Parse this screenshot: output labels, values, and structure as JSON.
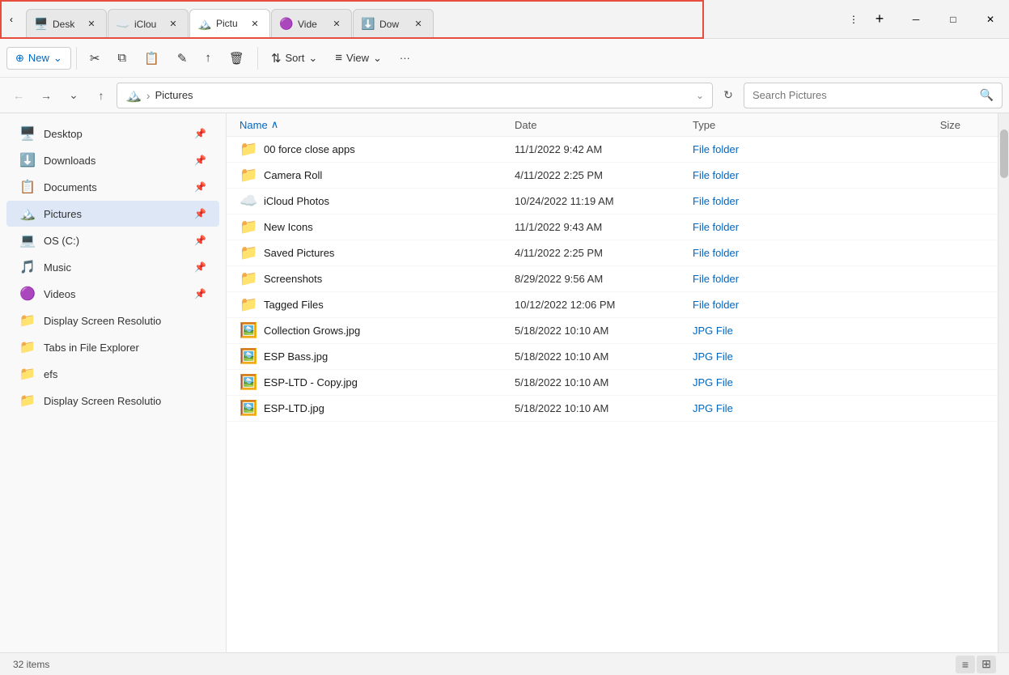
{
  "window": {
    "title": "Pictures",
    "min_label": "─",
    "max_label": "□",
    "close_label": "✕"
  },
  "tabs": [
    {
      "id": "desktop",
      "label": "Desk",
      "icon": "🖥️",
      "active": false
    },
    {
      "id": "icloud",
      "label": "iClou",
      "icon": "☁️",
      "active": false
    },
    {
      "id": "pictures",
      "label": "Pictu",
      "icon": "🏔️",
      "active": true
    },
    {
      "id": "videos",
      "label": "Vide",
      "icon": "🟣",
      "active": false
    },
    {
      "id": "downloads",
      "label": "Dow",
      "icon": "⬇️",
      "active": false
    }
  ],
  "toolbar": {
    "new_label": "New",
    "sort_label": "Sort",
    "view_label": "View",
    "more_label": "···"
  },
  "address": {
    "back_label": "←",
    "forward_label": "→",
    "dropdown_label": "⌄",
    "up_label": "↑",
    "breadcrumb_icon": "🏔️",
    "breadcrumb_sep": "›",
    "breadcrumb_text": "Pictures",
    "refresh_label": "↻",
    "search_placeholder": "Search Pictures"
  },
  "sidebar": {
    "items": [
      {
        "id": "desktop",
        "icon": "🖥️",
        "label": "Desktop",
        "pinned": true
      },
      {
        "id": "downloads",
        "icon": "⬇️",
        "label": "Downloads",
        "pinned": true
      },
      {
        "id": "documents",
        "icon": "📋",
        "label": "Documents",
        "pinned": true
      },
      {
        "id": "pictures",
        "icon": "🏔️",
        "label": "Pictures",
        "pinned": true,
        "active": true
      },
      {
        "id": "osc",
        "icon": "💻",
        "label": "OS (C:)",
        "pinned": true
      },
      {
        "id": "music",
        "icon": "🎵",
        "label": "Music",
        "pinned": true
      },
      {
        "id": "videos",
        "icon": "🟣",
        "label": "Videos",
        "pinned": true
      },
      {
        "id": "display1",
        "icon": "📁",
        "label": "Display Screen Resolutio",
        "pinned": false
      },
      {
        "id": "tabs",
        "icon": "📁",
        "label": "Tabs in File Explorer",
        "pinned": false
      },
      {
        "id": "efs",
        "icon": "📁",
        "label": "efs",
        "pinned": false
      },
      {
        "id": "display2",
        "icon": "📁",
        "label": "Display Screen Resolutio",
        "pinned": false
      }
    ]
  },
  "content": {
    "headers": {
      "name": "Name",
      "name_sort_icon": "∧",
      "date": "Date",
      "type": "Type",
      "size": "Size"
    },
    "files": [
      {
        "name": "00 force close apps",
        "icon": "📁",
        "date": "11/1/2022 9:42 AM",
        "type": "File folder",
        "size": ""
      },
      {
        "name": "Camera Roll",
        "icon": "📁",
        "date": "4/11/2022 2:25 PM",
        "type": "File folder",
        "size": ""
      },
      {
        "name": "iCloud Photos",
        "icon": "☁️",
        "date": "10/24/2022 11:19 AM",
        "type": "File folder",
        "size": ""
      },
      {
        "name": "New Icons",
        "icon": "📁",
        "date": "11/1/2022 9:43 AM",
        "type": "File folder",
        "size": ""
      },
      {
        "name": "Saved Pictures",
        "icon": "📁",
        "date": "4/11/2022 2:25 PM",
        "type": "File folder",
        "size": ""
      },
      {
        "name": "Screenshots",
        "icon": "📁",
        "date": "8/29/2022 9:56 AM",
        "type": "File folder",
        "size": ""
      },
      {
        "name": "Tagged Files",
        "icon": "📁",
        "date": "10/12/2022 12:06 PM",
        "type": "File folder",
        "size": ""
      },
      {
        "name": "Collection Grows.jpg",
        "icon": "🖼️",
        "date": "5/18/2022 10:10 AM",
        "type": "JPG File",
        "size": ""
      },
      {
        "name": "ESP Bass.jpg",
        "icon": "🖼️",
        "date": "5/18/2022 10:10 AM",
        "type": "JPG File",
        "size": ""
      },
      {
        "name": "ESP-LTD - Copy.jpg",
        "icon": "🖼️",
        "date": "5/18/2022 10:10 AM",
        "type": "JPG File",
        "size": ""
      },
      {
        "name": "ESP-LTD.jpg",
        "icon": "🖼️",
        "date": "5/18/2022 10:10 AM",
        "type": "JPG File",
        "size": ""
      }
    ]
  },
  "status_bar": {
    "items_count": "32 items",
    "view_list_icon": "≡",
    "view_grid_icon": "⊞"
  }
}
